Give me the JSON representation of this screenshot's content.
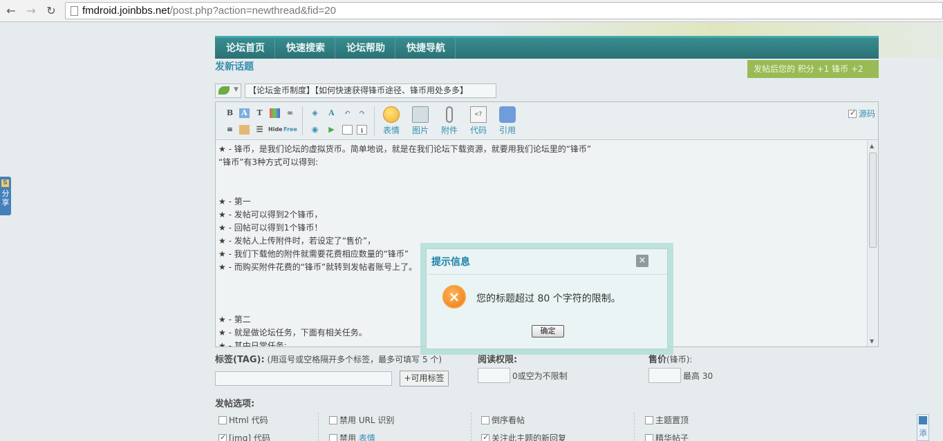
{
  "browser": {
    "url_host": "fmdroid.joinbbs.net",
    "url_path": "/post.php?action=newthread&fid=20"
  },
  "nav": [
    "论坛首页",
    "快速搜索",
    "论坛帮助",
    "快捷导航"
  ],
  "new_topic_title": "发新话题",
  "credit_tip": "发帖后您的 积分 +1  锋币 +2",
  "subject_value": "【论坛金币制度】【如何快速获得锋币途径、锋币用处多多】",
  "toolbar": {
    "big": [
      "表情",
      "图片",
      "附件",
      "代码",
      "引用"
    ],
    "source_label": "源码"
  },
  "content_lines": [
    "★ - 锋币，是我们论坛的虚拟货币。简单地说，就是在我们论坛下载资源，就要用我们论坛里的“锋币”",
    "“锋币”有3种方式可以得到:",
    "",
    "",
    "★ - 第一",
    "★ - 发帖可以得到2个锋币，",
    "★ - 回帖可以得到1个锋币！",
    "★ - 发帖人上传附件时，若设定了“售价”，",
    "★ - 我们下载他的附件就需要花费相应数量的“锋币”",
    "★ - 而购买附件花费的“锋币”就转到发帖者账号上了。",
    "",
    "",
    "",
    "★ - 第二",
    "★ - 就是做论坛任务，下面有相关任务。",
    "★ - 其中日常任务:"
  ],
  "tags": {
    "label": "标签(TAG):",
    "hint": " (用逗号或空格隔开多个标签，最多可填写 5 个)",
    "button": "+可用标签"
  },
  "read_perm": {
    "label": "阅读权限:",
    "hint": "0或空为不限制"
  },
  "price": {
    "label": "售价",
    "unit": "(锋币):",
    "hint": "最高 30"
  },
  "post_options": {
    "label": "发帖选项:",
    "items": [
      {
        "label": "Html 代码",
        "checked": false
      },
      {
        "label": "禁用 URL 识别",
        "checked": false
      },
      {
        "label": "倒序看帖",
        "checked": false
      },
      {
        "label": "主题置顶",
        "checked": false
      },
      {
        "label": "[img] 代码",
        "checked": true
      },
      {
        "label": "禁用 ",
        "link": "表情",
        "checked": false
      },
      {
        "label": "关注此主题的新回复",
        "checked": true
      },
      {
        "label": "精华帖子",
        "checked": false
      }
    ]
  },
  "side": {
    "share": "分享",
    "add": "添"
  },
  "dialog": {
    "title": "提示信息",
    "close": "×",
    "icon": "×",
    "message": "您的标题超过 80 个字符的限制。",
    "ok": "确定"
  }
}
